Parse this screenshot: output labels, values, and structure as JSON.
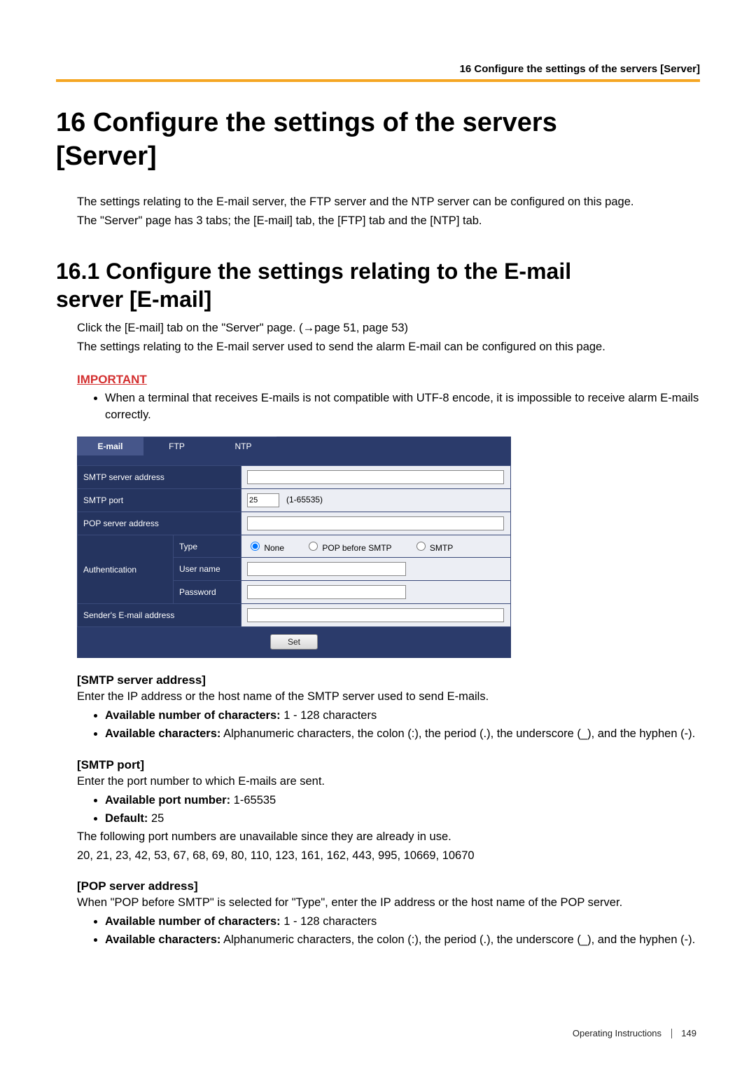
{
  "header": {
    "running_title": "16 Configure the settings of the servers [Server]"
  },
  "chapter": {
    "number": "16",
    "title_line1": "16   Configure the settings of the servers",
    "title_line2": "[Server]"
  },
  "intro": {
    "p1": "The settings relating to the E-mail server, the FTP server and the NTP server can be configured on this page.",
    "p2": "The \"Server\" page has 3 tabs; the [E-mail] tab, the [FTP] tab and the [NTP] tab."
  },
  "section": {
    "title_line1": "16.1  Configure the settings relating to the E-mail",
    "title_line2": "server [E-mail]"
  },
  "section_body": {
    "p1": "Click the [E-mail] tab on the \"Server\" page. (→page 51, page 53)",
    "p2": "The settings relating to the E-mail server used to send the alarm E-mail can be configured on this page."
  },
  "important": {
    "label": "IMPORTANT",
    "bullet1": "When a terminal that receives E-mails is not compatible with UTF-8 encode, it is impossible to receive alarm E-mails correctly."
  },
  "panel": {
    "tabs": {
      "email": "E-mail",
      "ftp": "FTP",
      "ntp": "NTP"
    },
    "rows": {
      "smtp_addr": "SMTP server address",
      "smtp_port": "SMTP port",
      "smtp_port_value": "25",
      "smtp_port_range": "(1-65535)",
      "pop_addr": "POP server address",
      "auth": "Authentication",
      "type": "Type",
      "type_opts": {
        "none": "None",
        "pop": "POP before SMTP",
        "smtp": "SMTP"
      },
      "user": "User name",
      "pass": "Password",
      "sender": "Sender's E-mail address"
    },
    "set_button": "Set"
  },
  "fields": {
    "smtp": {
      "title": "[SMTP server address]",
      "desc": "Enter the IP address or the host name of the SMTP server used to send E-mails.",
      "b1_pre": "Available number of characters:",
      "b1_post": " 1 - 128 characters",
      "b2_pre": "Available characters:",
      "b2_post": " Alphanumeric characters, the colon (:), the period (.), the underscore (_), and the hyphen (-)."
    },
    "port": {
      "title": "[SMTP port]",
      "desc": "Enter the port number to which E-mails are sent.",
      "b1_pre": "Available port number:",
      "b1_post": " 1-65535",
      "b2_pre": "Default:",
      "b2_post": " 25",
      "note1": "The following port numbers are unavailable since they are already in use.",
      "note2": "20, 21, 23, 42, 53, 67, 68, 69, 80, 110, 123, 161, 162, 443, 995, 10669, 10670"
    },
    "pop": {
      "title": "[POP server address]",
      "desc": "When \"POP before SMTP\" is selected for \"Type\", enter the IP address or the host name of the POP server.",
      "b1_pre": "Available number of characters:",
      "b1_post": " 1 - 128 characters",
      "b2_pre": "Available characters:",
      "b2_post": " Alphanumeric characters, the colon (:), the period (.), the underscore (_), and the hyphen (-)."
    }
  },
  "footer": {
    "label": "Operating Instructions",
    "page": "149"
  }
}
